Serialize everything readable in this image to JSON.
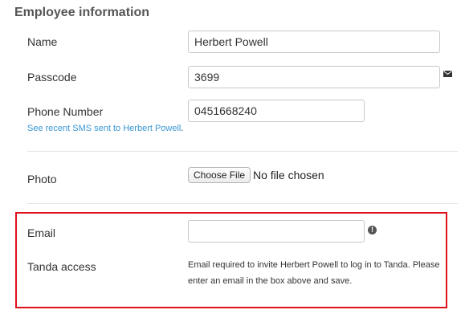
{
  "section": {
    "title": "Employee information"
  },
  "name": {
    "label": "Name",
    "value": "Herbert Powell"
  },
  "passcode": {
    "label": "Passcode",
    "value": "3699",
    "icon": "envelope-icon"
  },
  "phone": {
    "label": "Phone Number",
    "value": "0451668240",
    "sms_link": "See recent SMS sent to Herbert Powell",
    "sms_link_tail": "."
  },
  "photo": {
    "label": "Photo",
    "button_label": "Choose File",
    "status": "No file chosen"
  },
  "email": {
    "label": "Email",
    "value": "",
    "icon": "alert-icon",
    "icon_glyph": "!"
  },
  "tanda_access": {
    "label": "Tanda access",
    "help": "Email required to invite Herbert Powell to log in to Tanda. Please enter an email in the box above and save."
  },
  "colors": {
    "link": "#3a97d4",
    "highlight_border": "#e0101a",
    "text": "#333333"
  }
}
